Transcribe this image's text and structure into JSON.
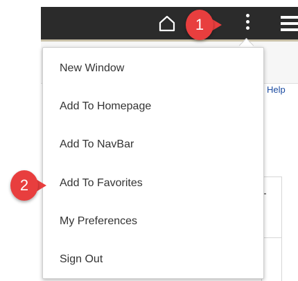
{
  "header": {
    "home_icon": "home-icon",
    "actions_icon": "kebab-menu-icon",
    "navbar_icon": "hamburger-icon",
    "background_color": "#2b2b2b"
  },
  "background": {
    "help_label": "Help"
  },
  "callouts": [
    {
      "number": "1",
      "color": "#e83e3e"
    },
    {
      "number": "2",
      "color": "#e83e3e"
    }
  ],
  "menu": {
    "items": [
      {
        "label": "New Window"
      },
      {
        "label": "Add To Homepage"
      },
      {
        "label": "Add To NavBar"
      },
      {
        "label": "Add To Favorites"
      },
      {
        "label": "My Preferences"
      },
      {
        "label": "Sign Out"
      }
    ]
  }
}
